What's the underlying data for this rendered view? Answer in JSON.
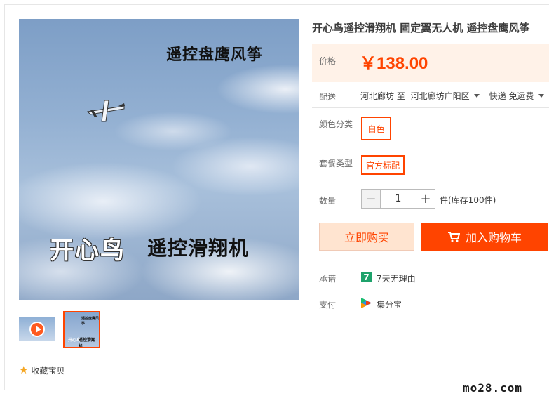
{
  "gallery": {
    "main_text_top": "遥控盘鹰风筝",
    "main_text_brand": "开心鸟",
    "main_text_name": "遥控滑翔机",
    "thumb_text_top": "遥控盘鹰风筝",
    "thumb_text_brand": "开心鸟",
    "thumb_text_name": "遥控滑翔机",
    "favorite_label": "收藏宝贝"
  },
  "product": {
    "title": "开心鸟遥控滑翔机 固定翼无人机 遥控盘鹰风筝",
    "price_label": "价格",
    "price_value": "￥138.00",
    "shipping_label": "配送",
    "ship_from": "河北廊坊 至",
    "ship_to": "河北廊坊广阳区",
    "ship_method": "快递 免运费",
    "color_label": "颜色分类",
    "color_option": "白色",
    "package_label": "套餐类型",
    "package_option": "官方标配",
    "quantity_label": "数量",
    "quantity_value": "1",
    "minus": "−",
    "plus": "+",
    "stock_text": "件(库存100件)",
    "buy_now": "立即购买",
    "add_to_cart": "加入购物车",
    "promise_label": "承诺",
    "promise_icon_text": "7",
    "promise_text": "7天无理由",
    "payment_label": "支付",
    "payment_text": "集分宝"
  },
  "colors": {
    "accent": "#ff4400",
    "price_bg": "#fff2e8",
    "buy_bg": "#ffe4d0",
    "promise_green": "#1ea26b",
    "star": "#f5a623"
  },
  "watermark": "mo28.com"
}
